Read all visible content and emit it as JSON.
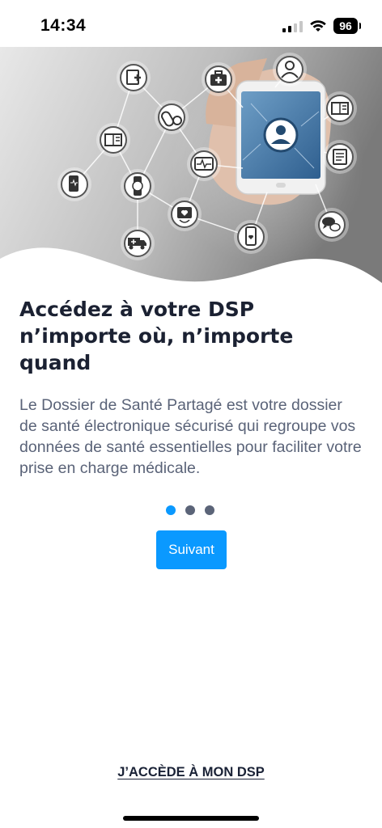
{
  "status_bar": {
    "time": "14:34",
    "battery_level": "96",
    "icons": [
      "signal-icon",
      "wifi-icon",
      "battery-icon"
    ]
  },
  "hero": {
    "icons": [
      "medical-document-icon",
      "medical-kit-icon",
      "doctor-icon",
      "patient-record-icon",
      "pills-icon",
      "smartwatch-icon",
      "heart-rate-monitor-icon",
      "smartphone-icon",
      "heart-monitor-device-icon",
      "ambulance-icon",
      "chat-icon",
      "hand-holding-phone-illustration"
    ]
  },
  "onboarding": {
    "title": "Accédez à votre DSP n’importe où, n’importe quand",
    "description": "Le Dossier de Santé Partagé est votre dossier de santé électronique sécurisé qui regroupe vos données de santé essentielles pour faciliter votre prise en charge médicale.",
    "pager": {
      "current": 1,
      "total": 3
    },
    "next_button_label": "Suivant"
  },
  "footer": {
    "access_link_label": "J’ACCÈDE À MON DSP"
  },
  "colors": {
    "accent": "#0a99ff",
    "dot_inactive": "#5b6478",
    "heading": "#1b2132",
    "body_text": "#5a6378"
  }
}
